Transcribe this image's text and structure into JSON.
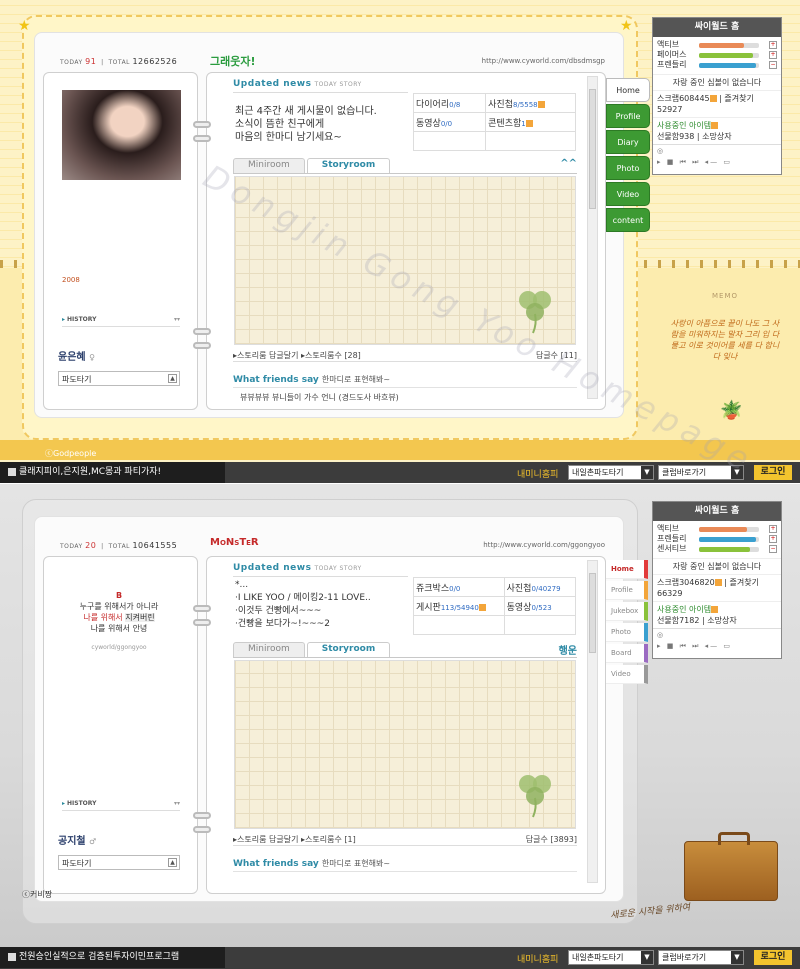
{
  "top": {
    "today_label": "TODAY",
    "today": "91",
    "total_label": "TOTAL",
    "total": "12662526",
    "title": "그래웃자!",
    "url": "http://www.cyworld.com/dbsdmsgp",
    "year": "2008",
    "history": "HISTORY",
    "name": "윤은혜",
    "name_icon": "♀",
    "pado": "파도타기",
    "updated_news": "Updated news",
    "today_story": "TODAY STORY",
    "news": [
      "최근 4주간 새 게시물이 없습니다.",
      "소식이 뜸한 친구에게",
      "마음의 한마디 남기세요~"
    ],
    "stats": [
      {
        "label": "다이어리",
        "count": "0/8"
      },
      {
        "label": "사진첩",
        "count": "8/5558"
      },
      {
        "label": "동영상",
        "count": "0/0"
      },
      {
        "label": "콘텐츠함",
        "count": "1"
      }
    ],
    "tab_miniroom": "Miniroom",
    "tab_storyroom": "Storyroom",
    "collapse_icon": "^^",
    "story_reply": "스토리룸 답글달기",
    "story_count": "스토리룸수 [28]",
    "reply_count": "답글수 [11]",
    "what_friends": "What friends say",
    "friends_sub": "한마디로 표현해봐~",
    "guest_line": "뷰뷰뷰뷰 뷰니들이 가수 언니 (경드도사 바흐뷰)",
    "side_tabs": [
      "Home",
      "Profile",
      "Diary",
      "Photo",
      "Video",
      "content"
    ],
    "credit": "ⓒGodpeople",
    "memo": "MEMO",
    "memo_text": "사랑이 아픔으로 끝이 나도 그 사람을 미워하지는 말자 그리 입 다물고 이로 것이어를 세를 다 합니다 잊나"
  },
  "top_panel": {
    "header": "싸이월드 홈",
    "bars": [
      {
        "label": "액티브",
        "color": "#e98a57",
        "pct": 0.75
      },
      {
        "label": "페이머스",
        "color": "#8ac23b",
        "pct": 0.9
      },
      {
        "label": "프렌들리",
        "color": "#3aa0d0",
        "pct": 0.95
      }
    ],
    "no_boast": "자랑 중인 심볼이 없습니다",
    "scrap_line": "스크랩608445",
    "fav_line": "즐겨찾기52927",
    "items": "사용중인 아이템",
    "gift": "선물함938",
    "wish": "소망상자"
  },
  "top_status": {
    "left": "클래지피이,은지원,MC몽과 파티가자!",
    "my_mini": "내미니홈피",
    "sel1": "내일촌파도타기",
    "sel2": "클럽바로가기",
    "login": "로그인"
  },
  "bottom": {
    "today_label": "TODAY",
    "today": "20",
    "total_label": "TOTAL",
    "total": "10641555",
    "title": "MoNsTeR",
    "url": "http://www.cyworld.com/ggongyoo",
    "left_text": [
      "B",
      "누구를 위해서가 아니라",
      "나를 위해서 ",
      "지켜버린",
      "나를 위해서 안녕",
      "cyworld/ggongyoo"
    ],
    "history": "HISTORY",
    "name": "공지철",
    "name_icon": "♂",
    "pado": "파도타기",
    "updated_news": "Updated news",
    "today_story": "TODAY STORY",
    "news": [
      "*...",
      "I LIKE YOO / 메이킹2-11 LOVE..",
      "이것두 건빵에서~~~",
      "건빵을 보다가~!~~~2"
    ],
    "stats": [
      {
        "label": "쥬크박스",
        "count": "0/0"
      },
      {
        "label": "사진첩",
        "count": "0/40279"
      },
      {
        "label": "게시판",
        "count": "113/54940"
      },
      {
        "label": "동영상",
        "count": "0/523"
      }
    ],
    "tab_miniroom": "Miniroom",
    "tab_storyroom": "Storyroom",
    "mini_label": "행운",
    "story_reply": "스토리룸 답글달기",
    "story_count": "스토리룸수 [1]",
    "reply_count": "답글수 [3893]",
    "what_friends": "What friends say",
    "friends_sub": "한마디로 표현해봐~",
    "side_tabs": [
      "Home",
      "Profile",
      "Jukebox",
      "Photo",
      "Board",
      "Video"
    ],
    "side_colors": [
      "#e23b3b",
      "#f3a53a",
      "#8ac23b",
      "#3aa0d0",
      "#9b6bc2",
      "#999999"
    ],
    "credit": "ⓒ커비짱",
    "ink": "새로운 시작을 위하여"
  },
  "bottom_panel": {
    "header": "싸이월드 홈",
    "bars": [
      {
        "label": "액티브",
        "color": "#e98a57",
        "pct": 0.8
      },
      {
        "label": "프렌들리",
        "color": "#3aa0d0",
        "pct": 0.95
      },
      {
        "label": "센서티브",
        "color": "#8ac23b",
        "pct": 0.85
      }
    ],
    "no_boast": "자랑 중인 심볼이 없습니다",
    "scrap_line": "스크랩3046820",
    "fav_line": "즐겨찾기66329",
    "items": "사용중인 아이템",
    "gift": "선물함7182",
    "wish": "소망상자"
  },
  "bottom_status": {
    "left": "전원승인실적으로 검증된투자이민프로그램",
    "my_mini": "내미니홈피",
    "sel1": "내일촌파도타기",
    "sel2": "클럽바로가기",
    "login": "로그인"
  },
  "watermark": "Dongjin Gong Yoo Homepage"
}
